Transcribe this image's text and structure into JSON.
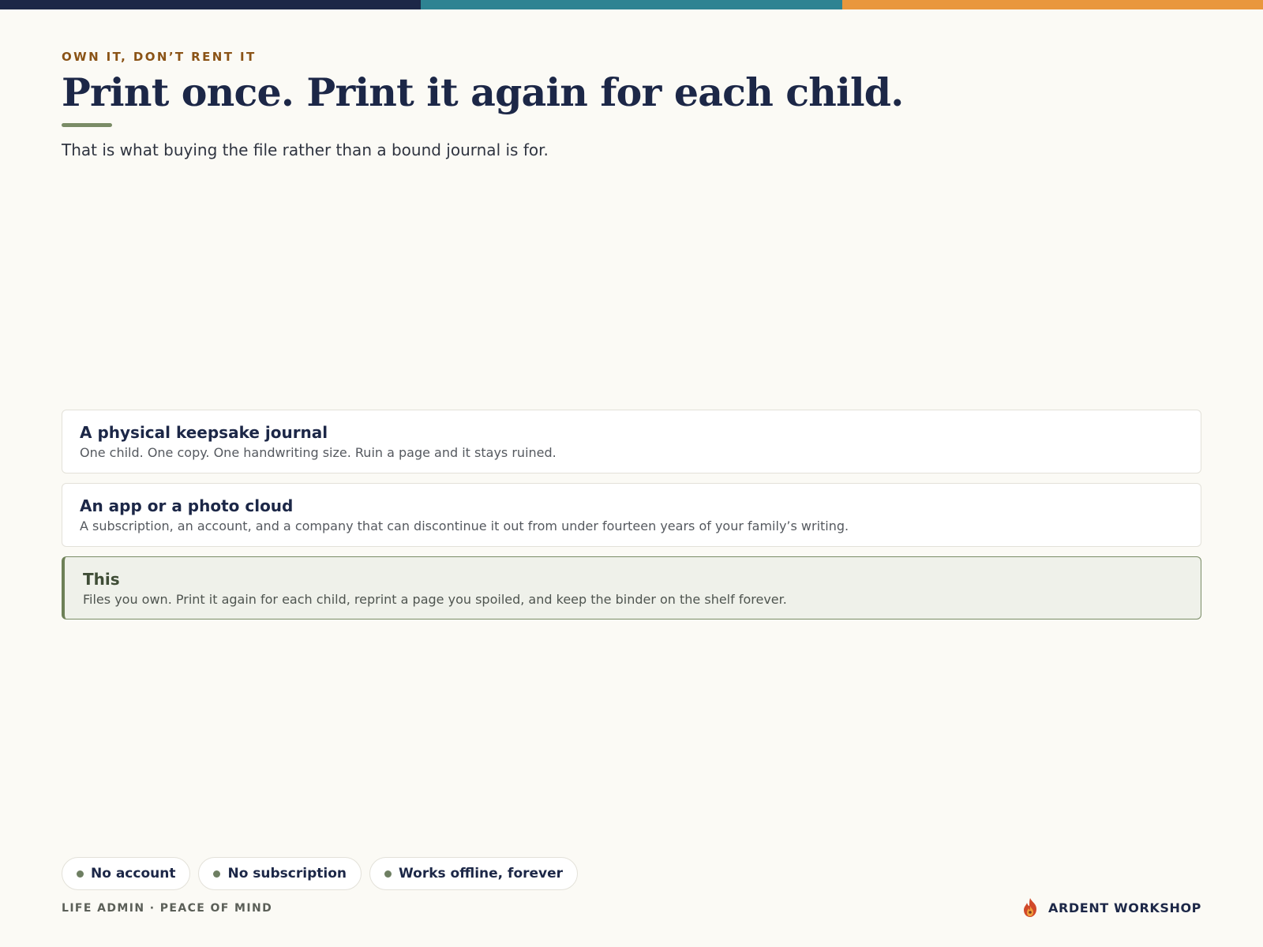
{
  "header": {
    "eyebrow": "OWN IT, DON’T RENT IT",
    "title": "Print once. Print it again for each child.",
    "subtitle": "That is what buying the file rather than a bound journal is for."
  },
  "options": [
    {
      "title": "A physical keepsake journal",
      "description": "One child. One copy. One handwriting size. Ruin a page and it stays ruined."
    },
    {
      "title": "An app or a photo cloud",
      "description": "A subscription, an account, and a company that can discontinue it out from under fourteen years of your family’s writing."
    },
    {
      "title": "This",
      "description": "Files you own. Print it again for each child, reprint a page you spoiled, and keep the binder on the shelf forever."
    }
  ],
  "pills": [
    "No account",
    "No subscription",
    "Works offline, forever"
  ],
  "footer": {
    "category": "LIFE ADMIN · PEACE OF MIND",
    "brand": "ARDENT WORKSHOP",
    "brand_icon": "flame-icon"
  },
  "colors": {
    "navy": "#1c2747",
    "teal": "#2e8392",
    "orange": "#e9973d",
    "sage": "#7a8c66",
    "eyebrow": "#8a5316",
    "background": "#fbfaf5"
  }
}
